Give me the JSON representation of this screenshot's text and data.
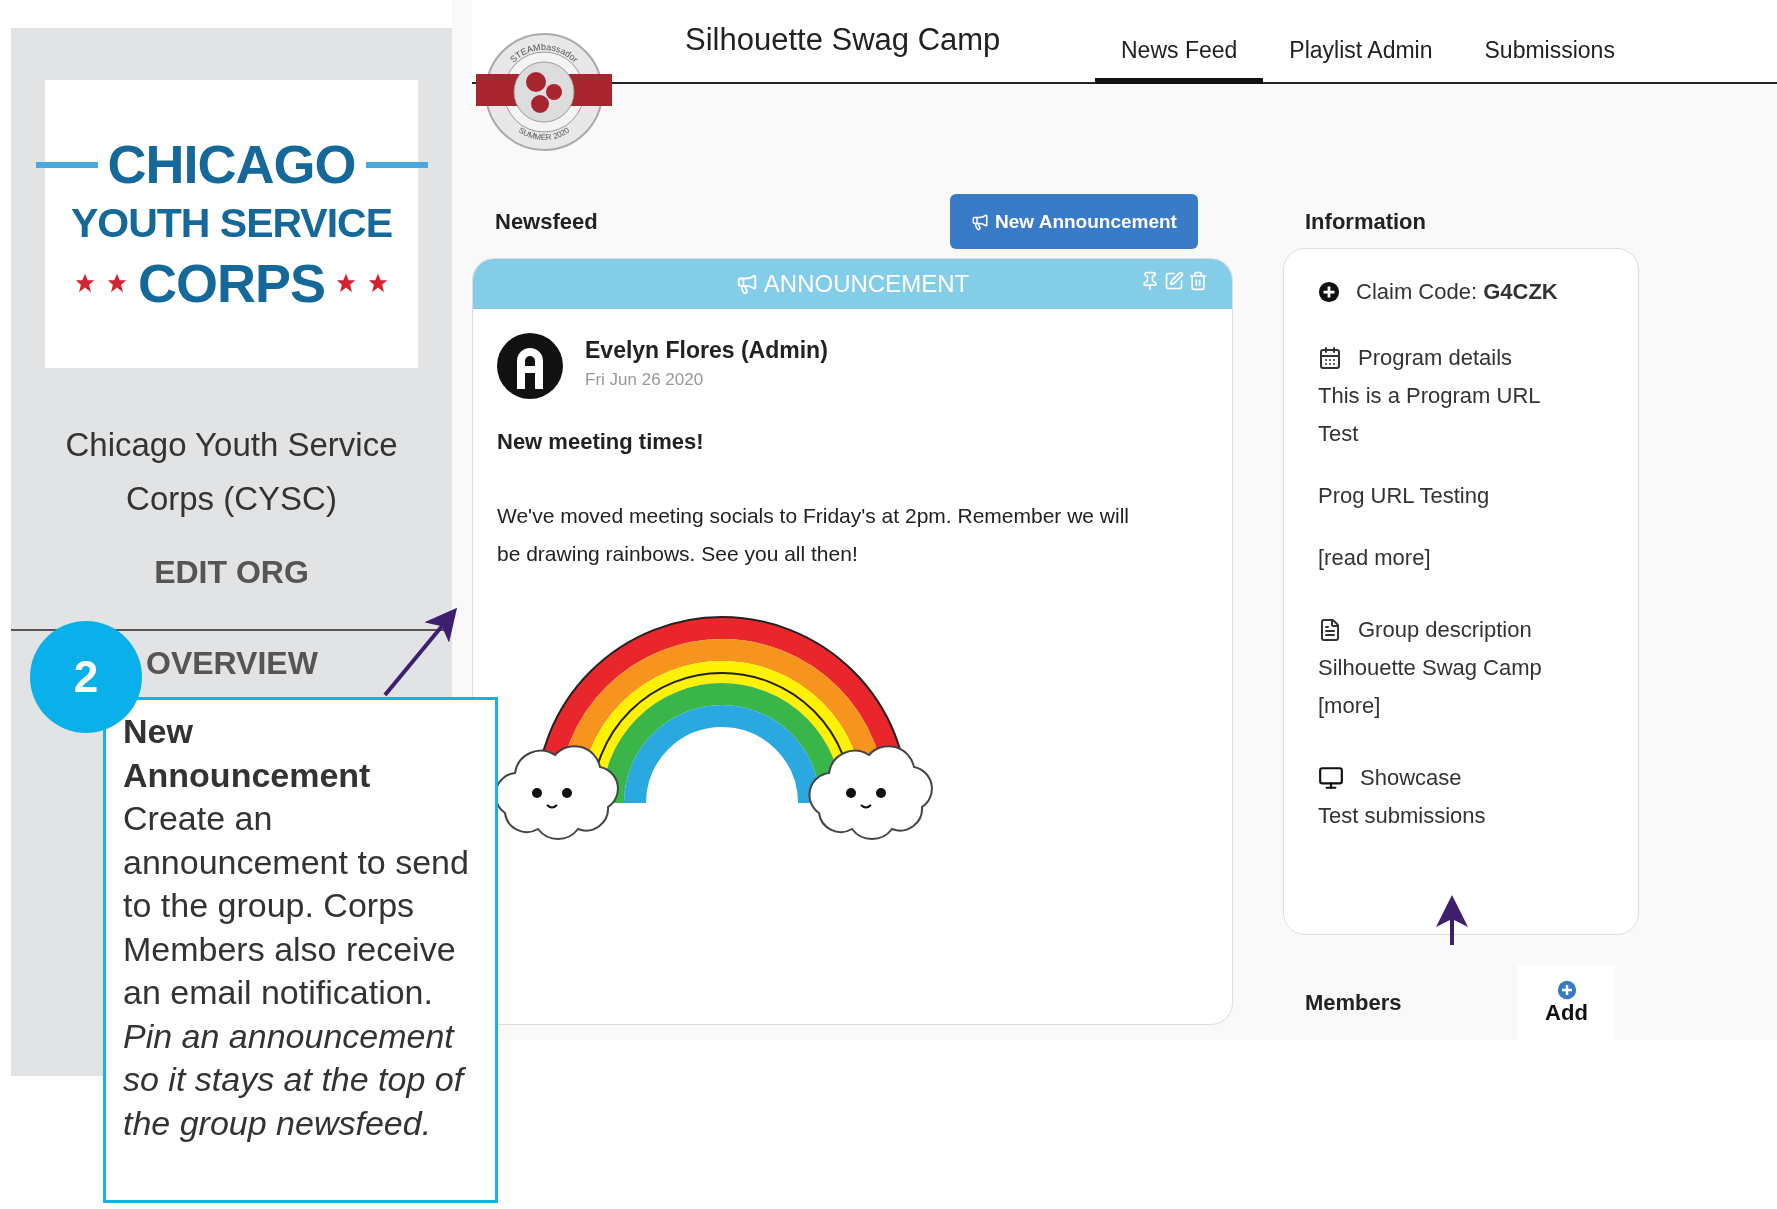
{
  "sidebar": {
    "logo": {
      "lines": [
        "CHICAGO",
        "YOUTH SERVICE",
        "CORPS"
      ]
    },
    "org_name": "Chicago Youth Service Corps (CYSC)",
    "edit_link": "EDIT ORG",
    "nav_items": [
      "OVERVIEW"
    ]
  },
  "header": {
    "badge": {
      "top_text": "STEAMbassador",
      "bottom_text": "SUMMER 2020"
    },
    "title": "Silhouette Swag Camp",
    "tabs": [
      {
        "label": "News Feed",
        "selected": true
      },
      {
        "label": "Playlist Admin",
        "selected": false
      },
      {
        "label": "Submissions",
        "selected": false
      }
    ]
  },
  "newsfeed": {
    "heading": "Newsfeed",
    "new_button": "New Announcement",
    "posts": [
      {
        "type_label": "ANNOUNCEMENT",
        "author": "Evelyn Flores (Admin)",
        "date": "Fri Jun 26 2020",
        "title": "New meeting times!",
        "body": "We've moved meeting socials to Friday's at 2pm. Remember we will be drawing rainbows. See you all then!"
      }
    ]
  },
  "information": {
    "heading": "Information",
    "items": [
      {
        "kind": "claim",
        "text": "Claim Code: **G4CZK**"
      },
      {
        "kind": "program",
        "title": "Program details",
        "lines": [
          "This is a Program URL Test",
          "Prog URL Testing"
        ],
        "link": "[read more]"
      },
      {
        "kind": "group",
        "title": "Group description",
        "lines": [
          "Silhouette Swag Camp"
        ],
        "link": "[more]"
      },
      {
        "kind": "showcase",
        "title": "Showcase",
        "lines": [
          "Test submissions"
        ]
      }
    ]
  },
  "members": {
    "heading": "Members",
    "add_button": "Add"
  },
  "callout": {
    "step": "2",
    "title": "New Announcement",
    "text": "Create an announcement to send to the group. Corps Members also receive an email notification. *Pin an announcement so it stays at the top of the group newsfeed.*"
  }
}
